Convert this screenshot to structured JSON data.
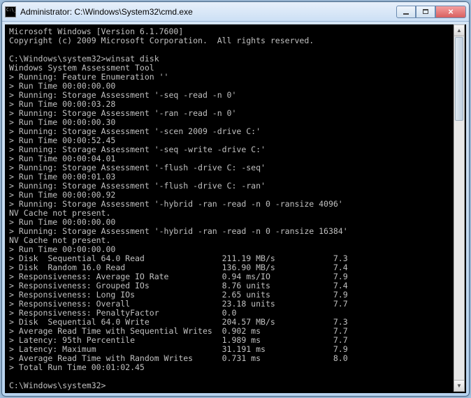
{
  "window": {
    "title": "Administrator: C:\\Windows\\System32\\cmd.exe"
  },
  "console": {
    "header1": "Microsoft Windows [Version 6.1.7600]",
    "header2": "Copyright (c) 2009 Microsoft Corporation.  All rights reserved.",
    "prompt1": "C:\\Windows\\system32>winsat disk",
    "tool": "Windows System Assessment Tool",
    "lines": [
      "> Running: Feature Enumeration ''",
      "> Run Time 00:00:00.00",
      "> Running: Storage Assessment '-seq -read -n 0'",
      "> Run Time 00:00:03.28",
      "> Running: Storage Assessment '-ran -read -n 0'",
      "> Run Time 00:00:00.30",
      "> Running: Storage Assessment '-scen 2009 -drive C:'",
      "> Run Time 00:00:52.45",
      "> Running: Storage Assessment '-seq -write -drive C:'",
      "> Run Time 00:00:04.01",
      "> Running: Storage Assessment '-flush -drive C: -seq'",
      "> Run Time 00:00:01.03",
      "> Running: Storage Assessment '-flush -drive C: -ran'",
      "> Run Time 00:00:00.92",
      "> Running: Storage Assessment '-hybrid -ran -read -n 0 -ransize 4096'",
      "NV Cache not present.",
      "> Run Time 00:00:00.00",
      "> Running: Storage Assessment '-hybrid -ran -read -n 0 -ransize 16384'",
      "NV Cache not present.",
      "> Run Time 00:00:00.00"
    ],
    "results": [
      {
        "label": "> Disk  Sequential 64.0 Read",
        "value": "211.19 MB/s",
        "score": "7.3"
      },
      {
        "label": "> Disk  Random 16.0 Read",
        "value": "136.90 MB/s",
        "score": "7.4"
      },
      {
        "label": "> Responsiveness: Average IO Rate",
        "value": "0.94 ms/IO",
        "score": "7.9"
      },
      {
        "label": "> Responsiveness: Grouped IOs",
        "value": "8.76 units",
        "score": "7.4"
      },
      {
        "label": "> Responsiveness: Long IOs",
        "value": "2.65 units",
        "score": "7.9"
      },
      {
        "label": "> Responsiveness: Overall",
        "value": "23.18 units",
        "score": "7.7"
      },
      {
        "label": "> Responsiveness: PenaltyFactor",
        "value": "0.0",
        "score": ""
      },
      {
        "label": "> Disk  Sequential 64.0 Write",
        "value": "204.57 MB/s",
        "score": "7.3"
      },
      {
        "label": "> Average Read Time with Sequential Writes",
        "value": "0.902 ms",
        "score": "7.7"
      },
      {
        "label": "> Latency: 95th Percentile",
        "value": "1.989 ms",
        "score": "7.7"
      },
      {
        "label": "> Latency: Maximum",
        "value": "31.191 ms",
        "score": "7.9"
      },
      {
        "label": "> Average Read Time with Random Writes",
        "value": "0.731 ms",
        "score": "8.0"
      }
    ],
    "total": "> Total Run Time 00:01:02.45",
    "prompt2": "C:\\Windows\\system32>"
  }
}
